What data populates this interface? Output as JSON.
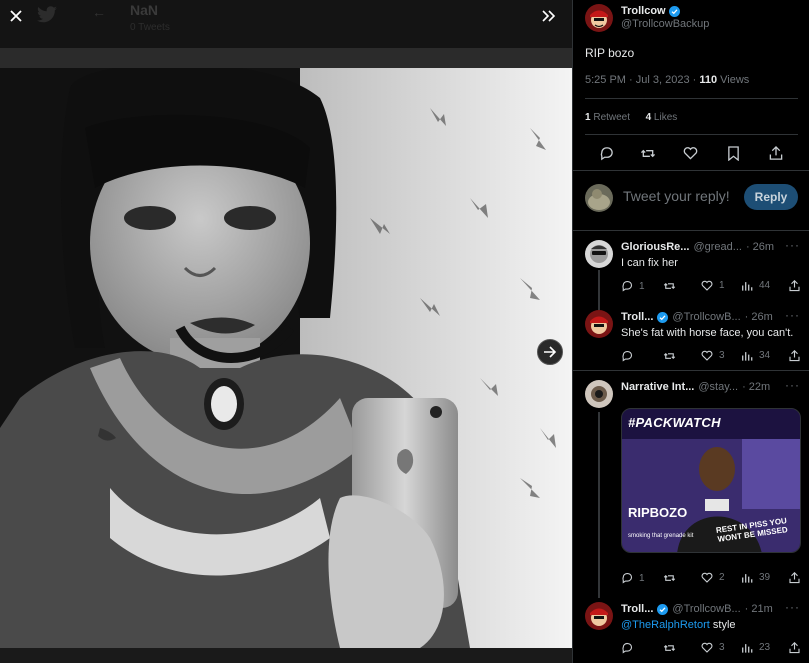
{
  "viewer": {
    "ghost_title": "NaN",
    "ghost_subtitle": "0 Tweets"
  },
  "main_post": {
    "display_name": "Trollcow",
    "handle": "@TrollcowBackup",
    "text": "RIP bozo",
    "time": "5:25 PM · Jul 3, 2023 · ",
    "views_count": "110",
    "views_label": " Views",
    "retweets_count": "1",
    "retweets_label": " Retweet",
    "likes_count": "4",
    "likes_label": " Likes"
  },
  "reply_box": {
    "placeholder": "Tweet your reply!",
    "button": "Reply"
  },
  "replies": [
    {
      "display_name": "GloriousRe...",
      "handle": "@gread...",
      "time": "· 26m",
      "text": "I can fix her",
      "replies": "1",
      "retweets": "",
      "likes": "1",
      "views": "44"
    },
    {
      "display_name": "Troll...",
      "handle": "@TrollcowB...",
      "time": "· 26m",
      "text": "She's fat with horse face, you can't.",
      "replies": "",
      "retweets": "",
      "likes": "3",
      "views": "34"
    },
    {
      "display_name": "Narrative Int...",
      "handle": "@stay...",
      "time": "· 22m",
      "text": "",
      "media": {
        "hashtag": "#PACKWATCH",
        "rip": "RIPBOZO",
        "caption_left": "smoking that grenade kit",
        "caption_right": "REST IN PISS YOU WONT BE MISSED"
      },
      "replies": "1",
      "retweets": "",
      "likes": "2",
      "views": "39"
    },
    {
      "display_name": "Troll...",
      "handle": "@TrollcowB...",
      "time": "· 21m",
      "mention": "@TheRalphRetort",
      "text": " style",
      "replies": "",
      "retweets": "",
      "likes": "3",
      "views": "23"
    }
  ],
  "colors": {
    "accent": "#1d9bf0",
    "reply_button_bg": "#1d4e75",
    "divider": "#2f3336",
    "muted_text": "#71767b"
  }
}
